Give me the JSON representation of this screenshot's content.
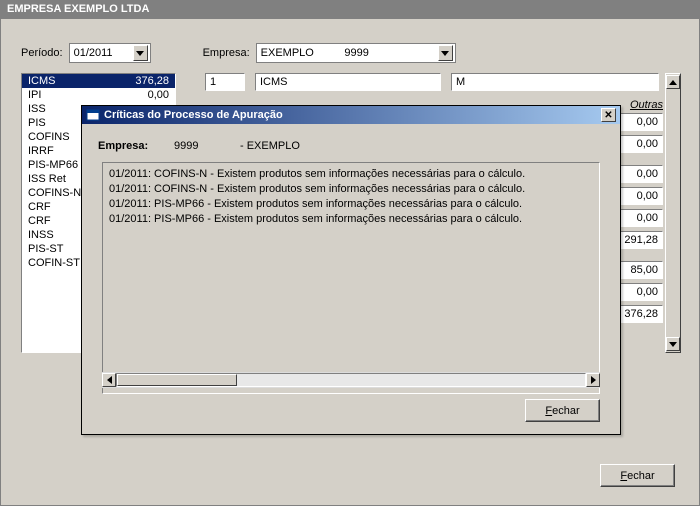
{
  "title": "EMPRESA EXEMPLO LTDA",
  "labels": {
    "periodo": "Período:",
    "empresa": "Empresa:",
    "outras": "Outras"
  },
  "periodo": "01/2011",
  "empresa_display": "EXEMPLO          9999",
  "taxes": [
    {
      "name": "ICMS",
      "value": "376,28"
    },
    {
      "name": "IPI",
      "value": "0,00"
    },
    {
      "name": "ISS",
      "value": ""
    },
    {
      "name": "PIS",
      "value": ""
    },
    {
      "name": "COFINS",
      "value": ""
    },
    {
      "name": "IRRF",
      "value": ""
    },
    {
      "name": "PIS-MP66",
      "value": ""
    },
    {
      "name": "ISS Ret",
      "value": ""
    },
    {
      "name": "COFINS-N",
      "value": ""
    },
    {
      "name": "CRF",
      "value": ""
    },
    {
      "name": "CRF",
      "value": ""
    },
    {
      "name": "INSS",
      "value": ""
    },
    {
      "name": "PIS-ST",
      "value": ""
    },
    {
      "name": "COFIN-ST",
      "value": ""
    }
  ],
  "detail": {
    "f1": "1",
    "f2": "ICMS",
    "f3": "M"
  },
  "right_values": [
    "0,00",
    "0,00",
    "",
    "0,00",
    "0,00",
    "0,00",
    "291,28",
    "",
    "85,00",
    "0,00",
    "376,28"
  ],
  "fechar_label": "Fechar",
  "modal": {
    "title": "Críticas do Processo de Apuração",
    "empresa_label": "Empresa:",
    "empresa_code": "9999",
    "empresa_name": "- EXEMPLO",
    "lines": [
      "01/2011: COFINS-N - Existem produtos sem informações necessárias para o cálculo.",
      "01/2011: COFINS-N - Existem produtos sem informações necessárias para o cálculo.",
      "01/2011: PIS-MP66 - Existem produtos sem informações necessárias para o cálculo.",
      "01/2011: PIS-MP66 - Existem produtos sem informações necessárias para o cálculo."
    ],
    "fechar_label": "Fechar"
  }
}
